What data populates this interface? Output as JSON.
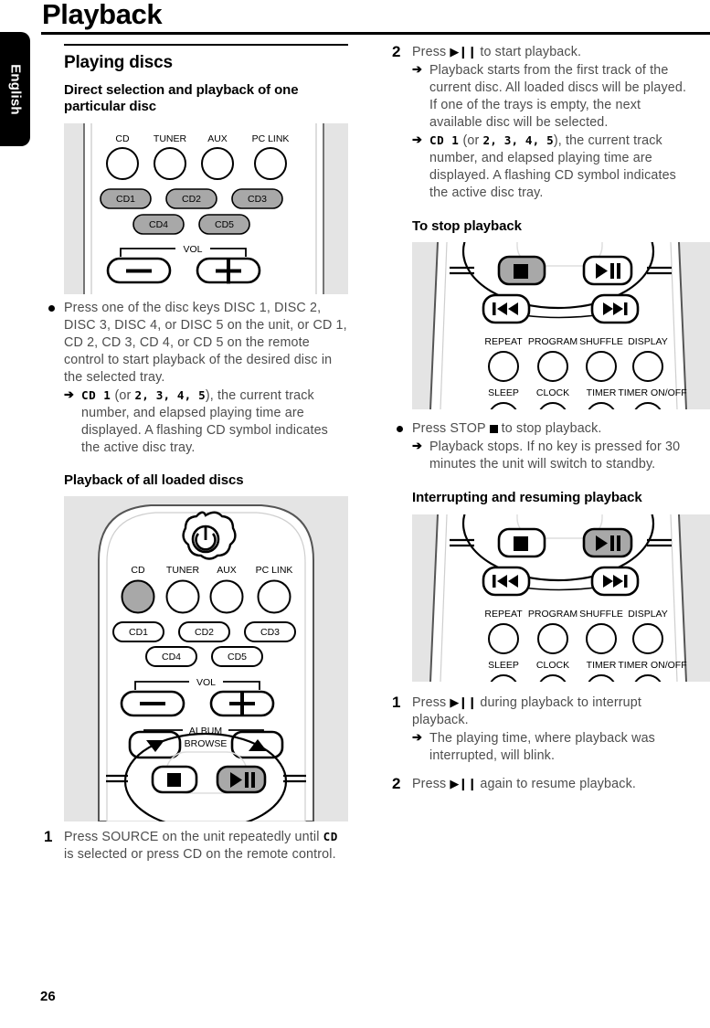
{
  "page": {
    "title": "Playback",
    "language_tab": "English",
    "number": "26"
  },
  "left_column": {
    "section_heading": "Playing discs",
    "sub_heading_1": "Direct selection and playback of one particular disc",
    "figure_1": {
      "name": "front-panel-source-keys",
      "source_labels": [
        "CD",
        "TUNER",
        "AUX",
        "PC LINK"
      ],
      "disc_keys": [
        "CD1",
        "CD2",
        "CD3",
        "CD4",
        "CD5"
      ],
      "vol_label": "VOL",
      "vol_minus": "−",
      "vol_plus": "+"
    },
    "bullet_1": {
      "text": "Press one of the disc keys DISC 1, DISC 2, DISC 3, DISC 4, or DISC 5 on the unit, or CD 1, CD 2, CD 3, CD 4, or CD 5 on the remote control to start playback of the desired disc in the selected tray.",
      "arrow_symbol": "➔",
      "arrow_lead_mono": "CD 1",
      "arrow_text_mid": " (or ",
      "arrow_numbers": "2, 3, 4, 5",
      "arrow_text_end": "), the current track number, and elapsed playing time are displayed. A flashing CD symbol indicates the active disc tray."
    },
    "sub_heading_2": "Playback of all loaded discs",
    "figure_2": {
      "name": "remote-control-top",
      "standby_icon": "power-icon",
      "source_labels": [
        "CD",
        "TUNER",
        "AUX",
        "PC LINK"
      ],
      "highlighted_source": "CD",
      "disc_keys": [
        "CD1",
        "CD2",
        "CD3",
        "CD4",
        "CD5"
      ],
      "vol_label": "VOL",
      "vol_minus": "−",
      "vol_plus": "+",
      "album_label": "ALBUM",
      "browse_label": "BROWSE",
      "browse_minus": "−",
      "browse_plus": "+",
      "highlighted_key": "play-pause"
    },
    "step_1": {
      "number": "1",
      "text_a": "Press SOURCE on the unit repeatedly until ",
      "mono": "CD",
      "text_b": " is selected or press CD on the remote control."
    }
  },
  "right_column": {
    "step_2": {
      "number": "2",
      "text_a": "Press ",
      "glyph": "▶❙❙",
      "text_b": " to start playback.",
      "arrow_symbol": "➔",
      "arrow_1": "Playback starts from the first track of the current disc. All loaded discs will be played. If one of the trays is empty, the next available disc will be selected.",
      "arrow_2_lead_mono": "CD 1",
      "arrow_2_mid": " (or ",
      "arrow_2_numbers": "2, 3, 4, 5",
      "arrow_2_end": "), the current track number, and elapsed playing time are displayed. A flashing CD symbol indicates the active disc tray."
    },
    "sub_heading_1": "To stop playback",
    "figure_3": {
      "name": "remote-control-transport-stop",
      "transport_labels": [
        "REPEAT",
        "PROGRAM",
        "SHUFFLE",
        "DISPLAY"
      ],
      "bottom_labels": [
        "SLEEP",
        "CLOCK",
        "TIMER",
        "TIMER ON/OFF"
      ],
      "highlighted_key": "stop"
    },
    "bullet_1": {
      "text_a": "Press STOP ",
      "text_b": " to stop playback.",
      "arrow_symbol": "➔",
      "arrow_text": "Playback stops. If no key is pressed for 30 minutes the unit will switch to standby."
    },
    "sub_heading_2": "Interrupting and resuming playback",
    "figure_4": {
      "name": "remote-control-transport-play",
      "transport_labels": [
        "REPEAT",
        "PROGRAM",
        "SHUFFLE",
        "DISPLAY"
      ],
      "bottom_labels": [
        "SLEEP",
        "CLOCK",
        "TIMER",
        "TIMER ON/OFF"
      ],
      "highlighted_key": "play-pause"
    },
    "step_1": {
      "number": "1",
      "text_a": "Press ",
      "glyph": "▶❙❙",
      "text_b": " during playback to interrupt playback.",
      "arrow_symbol": "➔",
      "arrow_text": "The playing time, where playback was interrupted, will blink."
    },
    "step_2b": {
      "number": "2",
      "text_a": "Press ",
      "glyph": "▶❙❙",
      "text_b": " again to resume playback."
    }
  },
  "colors": {
    "figure_background": "#e4e4e4",
    "key_highlight": "#a8a8a8",
    "disc_key_fill": "#a8a8a8",
    "body_text": "#4d4d4d"
  }
}
